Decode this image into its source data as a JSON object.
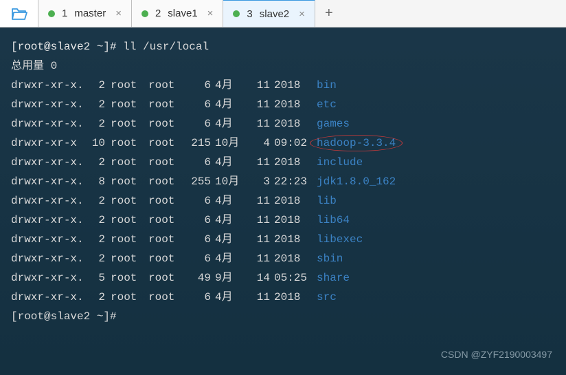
{
  "tabs": [
    {
      "index": "1",
      "label": "master",
      "active": false
    },
    {
      "index": "2",
      "label": "slave1",
      "active": false
    },
    {
      "index": "3",
      "label": "slave2",
      "active": true
    }
  ],
  "prompt": {
    "full": "[root@slave2 ~]#",
    "command": "ll /usr/local"
  },
  "summary": "总用量 0",
  "rows": [
    {
      "perm": "drwxr-xr-x.",
      "links": "2",
      "owner": "root",
      "group": "root",
      "size": "6",
      "month": "4月",
      "day": "11",
      "time": "2018",
      "name": "bin",
      "hl": false
    },
    {
      "perm": "drwxr-xr-x.",
      "links": "2",
      "owner": "root",
      "group": "root",
      "size": "6",
      "month": "4月",
      "day": "11",
      "time": "2018",
      "name": "etc",
      "hl": false
    },
    {
      "perm": "drwxr-xr-x.",
      "links": "2",
      "owner": "root",
      "group": "root",
      "size": "6",
      "month": "4月",
      "day": "11",
      "time": "2018",
      "name": "games",
      "hl": false
    },
    {
      "perm": "drwxr-xr-x",
      "links": "10",
      "owner": "root",
      "group": "root",
      "size": "215",
      "month": "10月",
      "day": "4",
      "time": "09:02",
      "name": "hadoop-3.3.4",
      "hl": true
    },
    {
      "perm": "drwxr-xr-x.",
      "links": "2",
      "owner": "root",
      "group": "root",
      "size": "6",
      "month": "4月",
      "day": "11",
      "time": "2018",
      "name": "include",
      "hl": false
    },
    {
      "perm": "drwxr-xr-x.",
      "links": "8",
      "owner": "root",
      "group": "root",
      "size": "255",
      "month": "10月",
      "day": "3",
      "time": "22:23",
      "name": "jdk1.8.0_162",
      "hl": false
    },
    {
      "perm": "drwxr-xr-x.",
      "links": "2",
      "owner": "root",
      "group": "root",
      "size": "6",
      "month": "4月",
      "day": "11",
      "time": "2018",
      "name": "lib",
      "hl": false
    },
    {
      "perm": "drwxr-xr-x.",
      "links": "2",
      "owner": "root",
      "group": "root",
      "size": "6",
      "month": "4月",
      "day": "11",
      "time": "2018",
      "name": "lib64",
      "hl": false
    },
    {
      "perm": "drwxr-xr-x.",
      "links": "2",
      "owner": "root",
      "group": "root",
      "size": "6",
      "month": "4月",
      "day": "11",
      "time": "2018",
      "name": "libexec",
      "hl": false
    },
    {
      "perm": "drwxr-xr-x.",
      "links": "2",
      "owner": "root",
      "group": "root",
      "size": "6",
      "month": "4月",
      "day": "11",
      "time": "2018",
      "name": "sbin",
      "hl": false
    },
    {
      "perm": "drwxr-xr-x.",
      "links": "5",
      "owner": "root",
      "group": "root",
      "size": "49",
      "month": "9月",
      "day": "14",
      "time": "05:25",
      "name": "share",
      "hl": false
    },
    {
      "perm": "drwxr-xr-x.",
      "links": "2",
      "owner": "root",
      "group": "root",
      "size": "6",
      "month": "4月",
      "day": "11",
      "time": "2018",
      "name": "src",
      "hl": false
    }
  ],
  "prompt2": "[root@slave2 ~]#",
  "watermark": "CSDN @ZYF2190003497"
}
